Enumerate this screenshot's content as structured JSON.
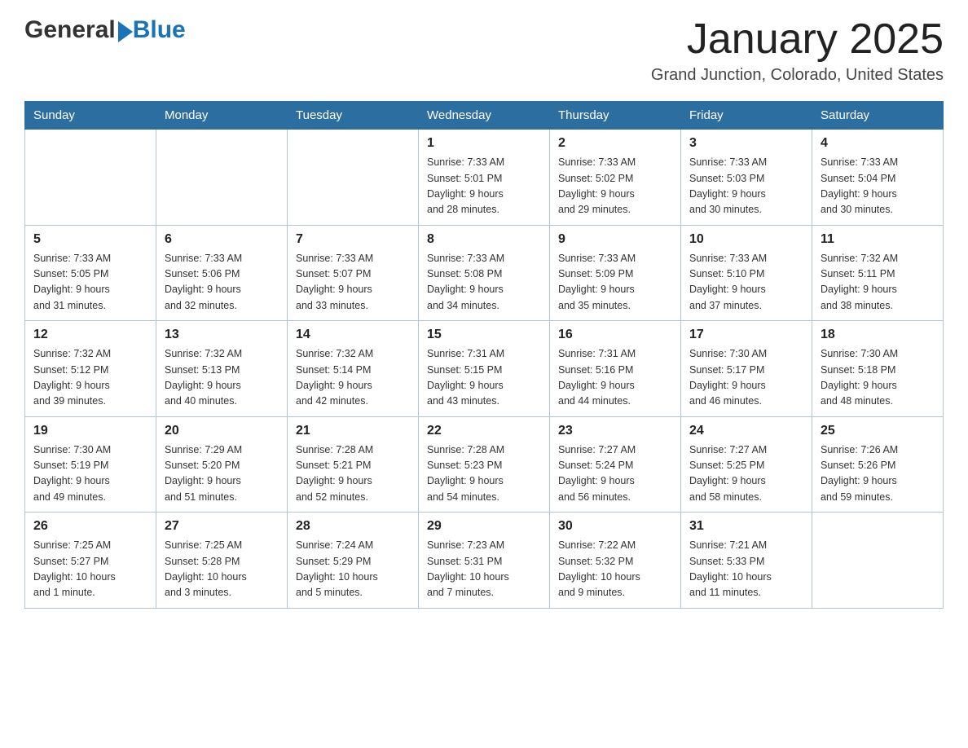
{
  "logo": {
    "general": "General",
    "blue": "Blue"
  },
  "title": "January 2025",
  "subtitle": "Grand Junction, Colorado, United States",
  "days_of_week": [
    "Sunday",
    "Monday",
    "Tuesday",
    "Wednesday",
    "Thursday",
    "Friday",
    "Saturday"
  ],
  "weeks": [
    [
      {
        "day": "",
        "info": ""
      },
      {
        "day": "",
        "info": ""
      },
      {
        "day": "",
        "info": ""
      },
      {
        "day": "1",
        "info": "Sunrise: 7:33 AM\nSunset: 5:01 PM\nDaylight: 9 hours\nand 28 minutes."
      },
      {
        "day": "2",
        "info": "Sunrise: 7:33 AM\nSunset: 5:02 PM\nDaylight: 9 hours\nand 29 minutes."
      },
      {
        "day": "3",
        "info": "Sunrise: 7:33 AM\nSunset: 5:03 PM\nDaylight: 9 hours\nand 30 minutes."
      },
      {
        "day": "4",
        "info": "Sunrise: 7:33 AM\nSunset: 5:04 PM\nDaylight: 9 hours\nand 30 minutes."
      }
    ],
    [
      {
        "day": "5",
        "info": "Sunrise: 7:33 AM\nSunset: 5:05 PM\nDaylight: 9 hours\nand 31 minutes."
      },
      {
        "day": "6",
        "info": "Sunrise: 7:33 AM\nSunset: 5:06 PM\nDaylight: 9 hours\nand 32 minutes."
      },
      {
        "day": "7",
        "info": "Sunrise: 7:33 AM\nSunset: 5:07 PM\nDaylight: 9 hours\nand 33 minutes."
      },
      {
        "day": "8",
        "info": "Sunrise: 7:33 AM\nSunset: 5:08 PM\nDaylight: 9 hours\nand 34 minutes."
      },
      {
        "day": "9",
        "info": "Sunrise: 7:33 AM\nSunset: 5:09 PM\nDaylight: 9 hours\nand 35 minutes."
      },
      {
        "day": "10",
        "info": "Sunrise: 7:33 AM\nSunset: 5:10 PM\nDaylight: 9 hours\nand 37 minutes."
      },
      {
        "day": "11",
        "info": "Sunrise: 7:32 AM\nSunset: 5:11 PM\nDaylight: 9 hours\nand 38 minutes."
      }
    ],
    [
      {
        "day": "12",
        "info": "Sunrise: 7:32 AM\nSunset: 5:12 PM\nDaylight: 9 hours\nand 39 minutes."
      },
      {
        "day": "13",
        "info": "Sunrise: 7:32 AM\nSunset: 5:13 PM\nDaylight: 9 hours\nand 40 minutes."
      },
      {
        "day": "14",
        "info": "Sunrise: 7:32 AM\nSunset: 5:14 PM\nDaylight: 9 hours\nand 42 minutes."
      },
      {
        "day": "15",
        "info": "Sunrise: 7:31 AM\nSunset: 5:15 PM\nDaylight: 9 hours\nand 43 minutes."
      },
      {
        "day": "16",
        "info": "Sunrise: 7:31 AM\nSunset: 5:16 PM\nDaylight: 9 hours\nand 44 minutes."
      },
      {
        "day": "17",
        "info": "Sunrise: 7:30 AM\nSunset: 5:17 PM\nDaylight: 9 hours\nand 46 minutes."
      },
      {
        "day": "18",
        "info": "Sunrise: 7:30 AM\nSunset: 5:18 PM\nDaylight: 9 hours\nand 48 minutes."
      }
    ],
    [
      {
        "day": "19",
        "info": "Sunrise: 7:30 AM\nSunset: 5:19 PM\nDaylight: 9 hours\nand 49 minutes."
      },
      {
        "day": "20",
        "info": "Sunrise: 7:29 AM\nSunset: 5:20 PM\nDaylight: 9 hours\nand 51 minutes."
      },
      {
        "day": "21",
        "info": "Sunrise: 7:28 AM\nSunset: 5:21 PM\nDaylight: 9 hours\nand 52 minutes."
      },
      {
        "day": "22",
        "info": "Sunrise: 7:28 AM\nSunset: 5:23 PM\nDaylight: 9 hours\nand 54 minutes."
      },
      {
        "day": "23",
        "info": "Sunrise: 7:27 AM\nSunset: 5:24 PM\nDaylight: 9 hours\nand 56 minutes."
      },
      {
        "day": "24",
        "info": "Sunrise: 7:27 AM\nSunset: 5:25 PM\nDaylight: 9 hours\nand 58 minutes."
      },
      {
        "day": "25",
        "info": "Sunrise: 7:26 AM\nSunset: 5:26 PM\nDaylight: 9 hours\nand 59 minutes."
      }
    ],
    [
      {
        "day": "26",
        "info": "Sunrise: 7:25 AM\nSunset: 5:27 PM\nDaylight: 10 hours\nand 1 minute."
      },
      {
        "day": "27",
        "info": "Sunrise: 7:25 AM\nSunset: 5:28 PM\nDaylight: 10 hours\nand 3 minutes."
      },
      {
        "day": "28",
        "info": "Sunrise: 7:24 AM\nSunset: 5:29 PM\nDaylight: 10 hours\nand 5 minutes."
      },
      {
        "day": "29",
        "info": "Sunrise: 7:23 AM\nSunset: 5:31 PM\nDaylight: 10 hours\nand 7 minutes."
      },
      {
        "day": "30",
        "info": "Sunrise: 7:22 AM\nSunset: 5:32 PM\nDaylight: 10 hours\nand 9 minutes."
      },
      {
        "day": "31",
        "info": "Sunrise: 7:21 AM\nSunset: 5:33 PM\nDaylight: 10 hours\nand 11 minutes."
      },
      {
        "day": "",
        "info": ""
      }
    ]
  ]
}
